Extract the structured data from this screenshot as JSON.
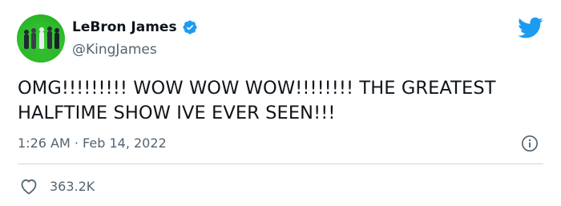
{
  "tweet": {
    "author_name": "LeBron James",
    "author_handle": "@KingJames",
    "verified": true,
    "text": "OMG!!!!!!!!! WOW WOW WOW!!!!!!!! THE GREATEST HALFTIME SHOW IVE EVER SEEN!!!",
    "time": "1:26 AM",
    "separator": "·",
    "date": "Feb 14, 2022",
    "like_count": "363.2K"
  },
  "icons": {
    "verified": "verified-badge-icon",
    "brand": "twitter-bird-icon",
    "info": "info-icon",
    "like": "heart-icon"
  },
  "colors": {
    "brand_blue": "#1d9bf0",
    "text_primary": "#0f1419",
    "text_secondary": "#536471",
    "divider": "#cfd9de",
    "avatar_bg": "#2fbe2c"
  }
}
